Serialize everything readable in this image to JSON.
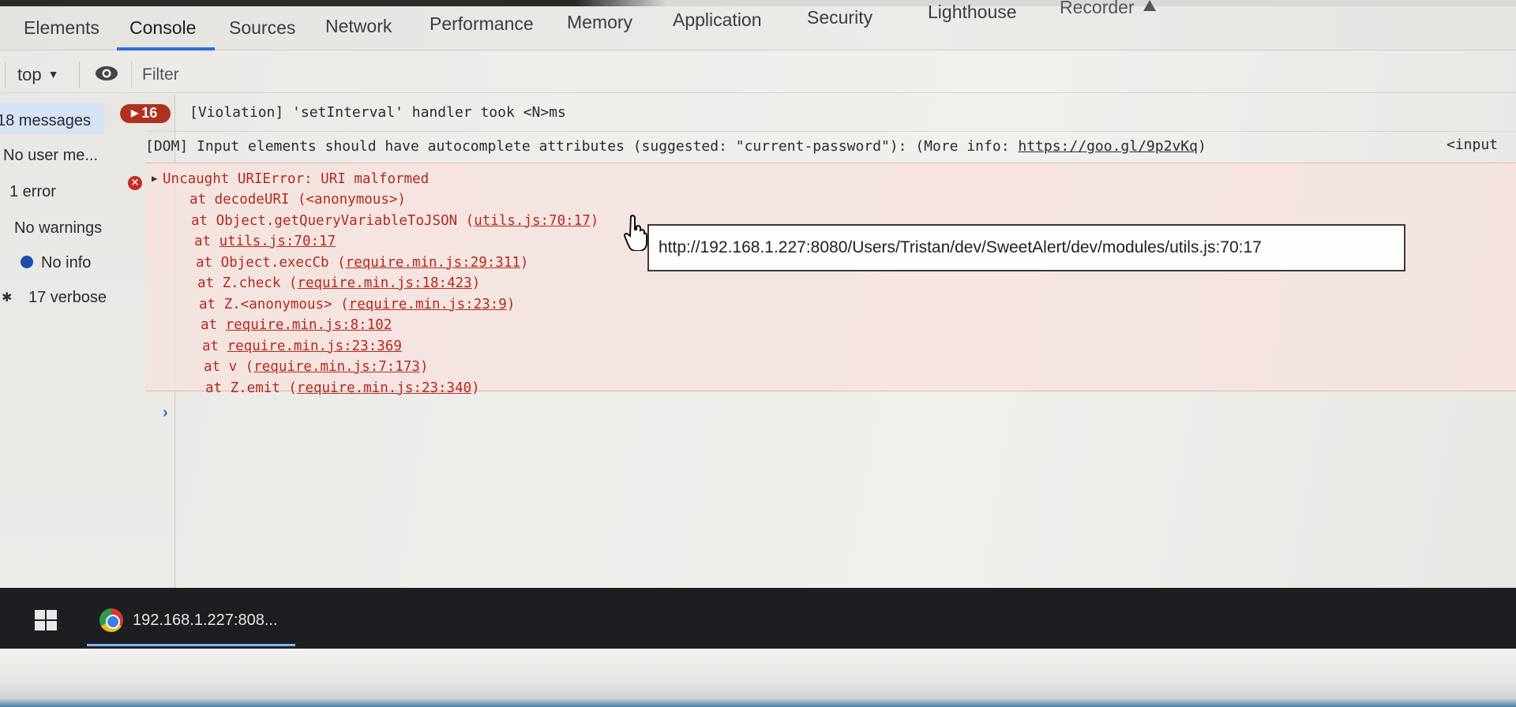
{
  "devtools": {
    "tabs": [
      {
        "label": "Elements"
      },
      {
        "label": "Console"
      },
      {
        "label": "Sources"
      },
      {
        "label": "Network"
      },
      {
        "label": "Performance"
      },
      {
        "label": "Memory"
      },
      {
        "label": "Application"
      },
      {
        "label": "Security"
      },
      {
        "label": "Lighthouse"
      },
      {
        "label": "Recorder"
      }
    ],
    "active_tab": "Console"
  },
  "toolbar": {
    "context": "top",
    "filter_placeholder": "Filter"
  },
  "sidebar": {
    "items": [
      {
        "label": "18 messages"
      },
      {
        "label": "No user me..."
      },
      {
        "label": "1 error"
      },
      {
        "label": "No warnings"
      },
      {
        "label": "No info"
      },
      {
        "label": "17 verbose"
      }
    ]
  },
  "console": {
    "violation": {
      "count": "16",
      "text": "[Violation] 'setInterval' handler took <N>ms"
    },
    "dom_message": {
      "text": "[DOM] Input elements should have autocomplete attributes (suggested: \"current-password\"): (More info: ",
      "link": "https://goo.gl/9p2vKq",
      "close": ")",
      "tail": "<input"
    },
    "error": {
      "title": "Uncaught URIError: URI malformed",
      "stack": [
        {
          "prefix": "at decodeURI (<anonymous>)",
          "link": "",
          "suffix": ""
        },
        {
          "prefix": "at Object.getQueryVariableToJSON (",
          "link": "utils.js:70:17",
          "suffix": ")"
        },
        {
          "prefix": "at ",
          "link": "utils.js:70:17",
          "suffix": ""
        },
        {
          "prefix": "at Object.execCb (",
          "link": "require.min.js:29:311",
          "suffix": ")"
        },
        {
          "prefix": "at Z.check (",
          "link": "require.min.js:18:423",
          "suffix": ")"
        },
        {
          "prefix": "at Z.<anonymous> (",
          "link": "require.min.js:23:9",
          "suffix": ")"
        },
        {
          "prefix": "at ",
          "link": "require.min.js:8:102",
          "suffix": ""
        },
        {
          "prefix": "at ",
          "link": "require.min.js:23:369",
          "suffix": ""
        },
        {
          "prefix": "at v (",
          "link": "require.min.js:7:173",
          "suffix": ")"
        },
        {
          "prefix": "at Z.emit (",
          "link": "require.min.js:23:340",
          "suffix": ")"
        }
      ]
    },
    "tooltip": "http://192.168.1.227:8080/Users/Tristan/dev/SweetAlert/dev/modules/utils.js:70:17",
    "prompt": "›"
  },
  "taskbar": {
    "window_label": "192.168.1.227:808..."
  },
  "colors": {
    "accent": "#2f6fd6",
    "error": "#b42a1c",
    "badge": "#b0311d"
  },
  "icons": [
    "eye-icon",
    "triangle-icon",
    "error-icon",
    "cursor-hand-icon",
    "windows-icon",
    "chrome-icon"
  ]
}
